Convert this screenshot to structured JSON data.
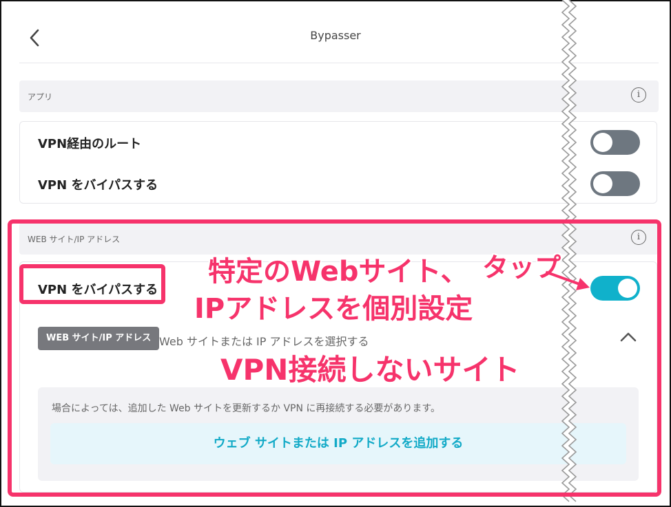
{
  "header": {
    "title": "Bypasser"
  },
  "apps_section": {
    "label": "アプリ",
    "info": "i"
  },
  "apps_card": {
    "rows": [
      {
        "label": "VPN経由のルート",
        "toggle_on": false
      },
      {
        "label": "VPN をバイパスする",
        "toggle_on": false
      }
    ]
  },
  "web_section": {
    "label": "WEB サイト/IP アドレス",
    "info": "i"
  },
  "web_card": {
    "row_label": "VPN をバイパスする",
    "toggle_on": true,
    "pill_label": "WEB サイト/IP アドレス",
    "pill_hint": "Web サイトまたは IP アドレスを選択する",
    "note_text": "場合によっては、追加した Web サイトを更新するか VPN に再接続する必要があります。",
    "add_button_label": "ウェブ サイトまたは IP アドレスを追加する"
  },
  "annotations": {
    "tap": "タップ",
    "line1": "特定のWebサイト、",
    "line2": "IPアドレスを個別設定",
    "no_vpn": "VPN接続しないサイト"
  },
  "colors": {
    "accent": "#f6336b",
    "toggle_on": "#10b1cb",
    "toggle_off": "#6e7780",
    "link": "#12aac7"
  }
}
